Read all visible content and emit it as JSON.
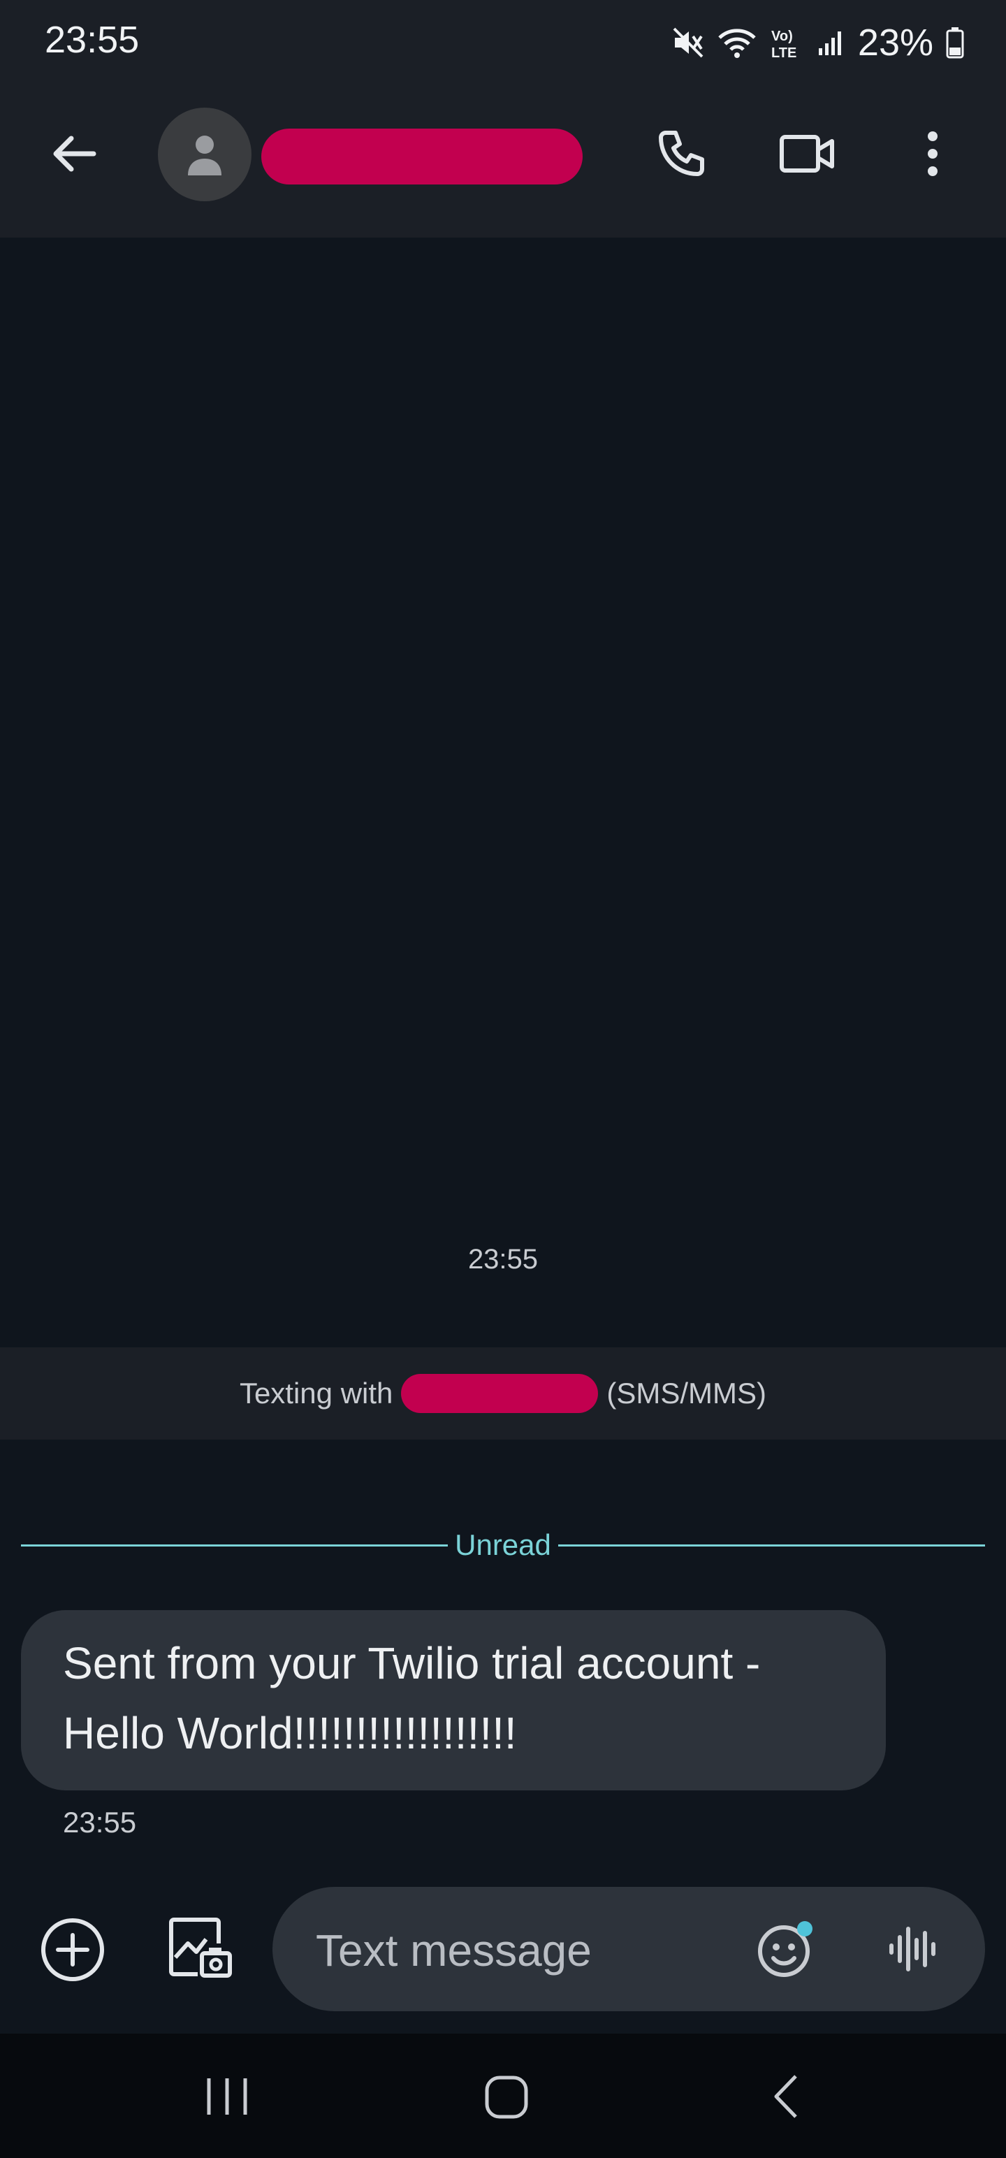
{
  "status_bar": {
    "time": "23:55",
    "battery": "23%",
    "icons": [
      "mute-icon",
      "wifi-icon",
      "volte-icon",
      "signal-icon",
      "battery-icon"
    ],
    "volte_label": "Vo) LTE"
  },
  "app_bar": {
    "icons": [
      "back-arrow-icon",
      "person-icon",
      "phone-icon",
      "video-call-icon",
      "more-vert-icon"
    ]
  },
  "conversation": {
    "timestamp": "23:55",
    "texting_prefix": "Texting with",
    "texting_suffix": "(SMS/MMS)",
    "unread_label": "Unread",
    "messages": [
      {
        "text": "Sent from your Twilio trial account -\nHello World!!!!!!!!!!!!!!!!!!",
        "time": "23:55"
      }
    ]
  },
  "composer": {
    "placeholder": "Text message",
    "icons": [
      "add-circle-icon",
      "gallery-camera-icon",
      "emoji-icon",
      "voice-waveform-icon"
    ]
  },
  "nav_bar": {
    "icons": [
      "recent-apps-icon",
      "home-icon",
      "back-icon"
    ]
  },
  "colors": {
    "background": "#0f151d",
    "surface": "#1b1f26",
    "bubble": "#2d333b",
    "accent_unread": "#7bd3d8",
    "redaction": "#c2004f"
  }
}
